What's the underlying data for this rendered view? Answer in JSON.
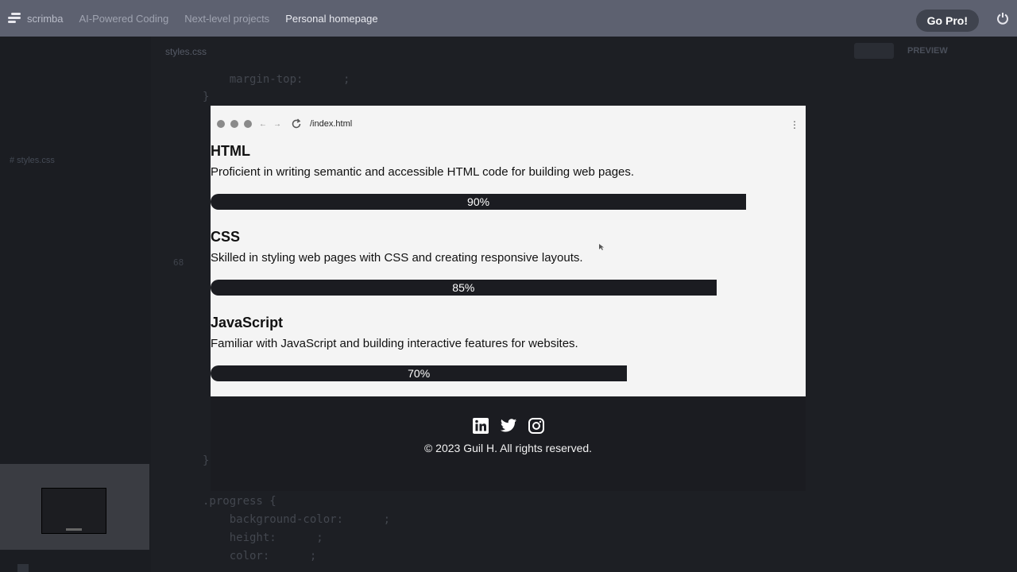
{
  "app": {
    "logo_text": "scrimba",
    "breadcrumbs": [
      "AI-Powered Coding",
      "Next-level projects",
      "Personal homepage"
    ],
    "go_pro_label": "Go Pro!"
  },
  "editor": {
    "active_tab": "styles.css",
    "sidebar_file": "# styles.css",
    "preview_label": "PREVIEW",
    "line_number": "68",
    "code_top": "    margin-top:      ;",
    "code_brace_top": "}",
    "code_brace_mid": "}",
    "code_bottom": ".progress {\n    background-color:      ;\n    height:      ;\n    color:      ;"
  },
  "browser": {
    "url": "/index.html",
    "more_icon": "⋮"
  },
  "skills": [
    {
      "title": "HTML",
      "description": "Proficient in writing semantic and accessible HTML code for building web pages.",
      "progress_label": "90%",
      "progress": 0.9
    },
    {
      "title": "CSS",
      "description": "Skilled in styling web pages with CSS and creating responsive layouts.",
      "progress_label": "85%",
      "progress": 0.85
    },
    {
      "title": "JavaScript",
      "description": "Familiar with JavaScript and building interactive features for websites.",
      "progress_label": "70%",
      "progress": 0.7
    }
  ],
  "footer": {
    "social_icons": [
      "linkedin-icon",
      "twitter-icon",
      "instagram-icon"
    ],
    "copyright": "© 2023 Guil H. All rights reserved."
  },
  "colors": {
    "topbar": "#5d6170",
    "progress_bar": "#1b1c21",
    "footer_bg": "#1b1c21",
    "preview_bg": "#f4f4f4"
  }
}
